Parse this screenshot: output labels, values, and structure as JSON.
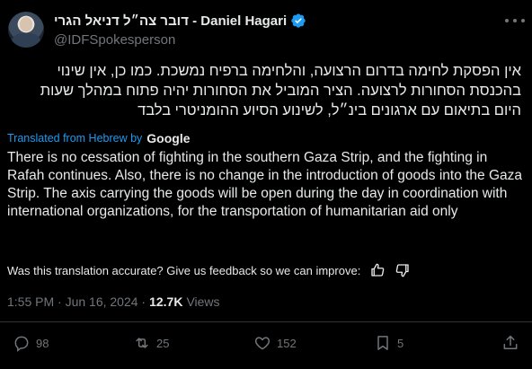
{
  "author": {
    "display_name": "דובר צה״ל דניאל הגרי - Daniel Hagari",
    "handle": "@IDFSpokesperson",
    "verified_color": "#1d9bf0"
  },
  "tweet": {
    "hebrew_lines": [
      "אין הפסקת לחימה בדרום הרצועה, והלחימה ברפיח נמשכת. כמו כן, אין שינוי",
      "בהכנסת הסחורות לרצועה. הציר המוביל את הסחורות יהיה פתוח במהלך שעות",
      "היום בתיאום עם ארגונים בינ״ל, לשינוע הסיוע ההומניטרי בלבד"
    ],
    "translated_label": "Translated from Hebrew by",
    "translator": "Google",
    "english_text": "There is no cessation of fighting in the southern Gaza Strip, and the fighting in Rafah continues. Also, there is no change in the introduction of goods into the Gaza Strip. The axis carrying the goods will be open during the day in coordination with international organizations, for the transportation of humanitarian aid only",
    "feedback_prompt": "Was this translation accurate? Give us feedback so we can improve:",
    "timestamp": "1:55 PM · Jun 16, 2024 ·",
    "views_count": "12.7K",
    "views_label": "Views"
  },
  "actions": {
    "replies": "98",
    "reposts": "25",
    "likes": "152",
    "bookmarks": "5"
  },
  "icons": {
    "more": "more-icon",
    "reply": "reply-icon",
    "repost": "repost-icon",
    "like": "heart-icon",
    "bookmark": "bookmark-icon",
    "share": "share-icon",
    "thumbs_up": "thumbs-up-icon",
    "thumbs_down": "thumbs-down-icon"
  },
  "colors": {
    "accent": "#1d9bf0",
    "muted": "#71767b",
    "text": "#e7e9ea",
    "background": "#000000"
  }
}
